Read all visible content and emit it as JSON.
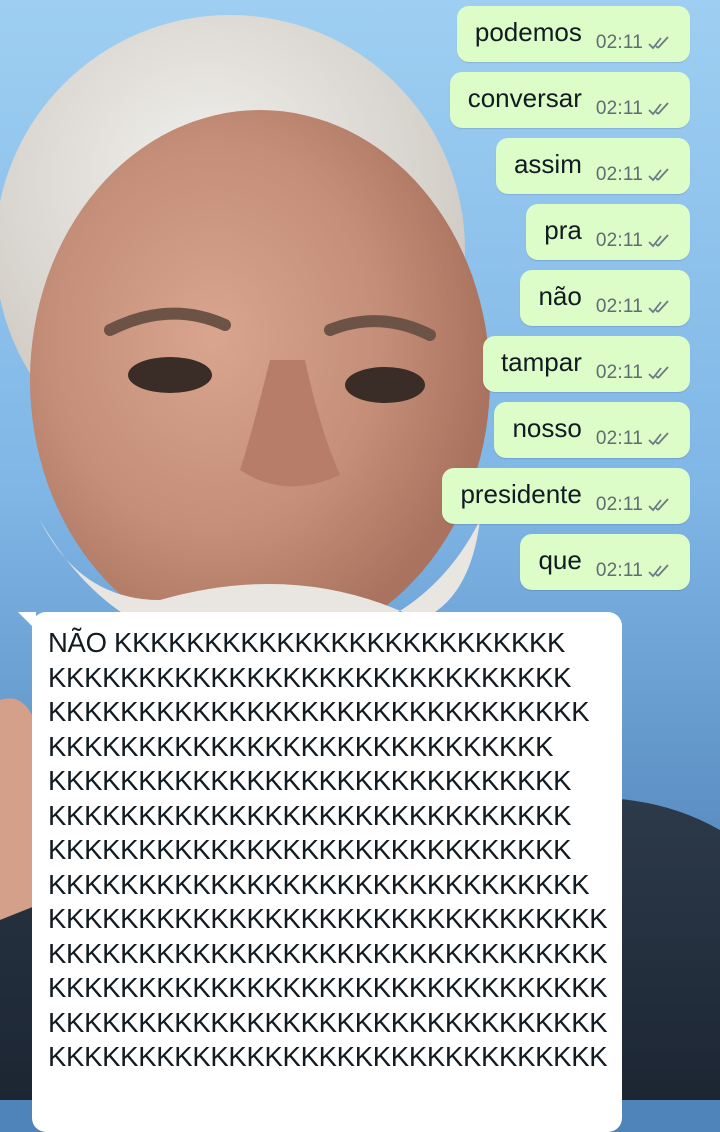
{
  "colors": {
    "outgoing_bubble": "#dcfcc8",
    "incoming_bubble": "#ffffff",
    "text": "#111b21",
    "meta_text": "#5f6d73",
    "background_sky": "#8fc3ee"
  },
  "icons": {
    "delivered": "double-check-icon"
  },
  "outgoing_messages": [
    {
      "text": "podemos",
      "time": "02:11"
    },
    {
      "text": "conversar",
      "time": "02:11"
    },
    {
      "text": "assim",
      "time": "02:11"
    },
    {
      "text": "pra",
      "time": "02:11"
    },
    {
      "text": "não",
      "time": "02:11"
    },
    {
      "text": "tampar",
      "time": "02:11"
    },
    {
      "text": "nosso",
      "time": "02:11"
    },
    {
      "text": "presidente",
      "time": "02:11"
    },
    {
      "text": "que",
      "time": "02:11"
    }
  ],
  "incoming_message": {
    "lines": [
      "NÃO KKKKKKKKKKKKKKKKKKKKKKKKK",
      "KKKKKKKKKKKKKKKKKKKKKKKKKKKKK",
      "KKKKKKKKKKKKKKKKKKKKKKKKKKKKKK",
      "KKKKKKKKKKKKKKKKKKKKKKKKKKKK",
      "KKKKKKKKKKKKKKKKKKKKKKKKKKKKK",
      "KKKKKKKKKKKKKKKKKKKKKKKKKKKKK",
      "KKKKKKKKKKKKKKKKKKKKKKKKKKKKK",
      "KKKKKKKKKKKKKKKKKKKKKKKKKKKKKK",
      "KKKKKKKKKKKKKKKKKKKKKKKKKKKKKKK",
      "KKKKKKKKKKKKKKKKKKKKKKKKKKKKKKK",
      "KKKKKKKKKKKKKKKKKKKKKKKKKKKKKKK",
      "KKKKKKKKKKKKKKKKKKKKKKKKKKKKKKK",
      "KKKKKKKKKKKKKKKKKKKKKKKKKKKKKKK"
    ]
  }
}
